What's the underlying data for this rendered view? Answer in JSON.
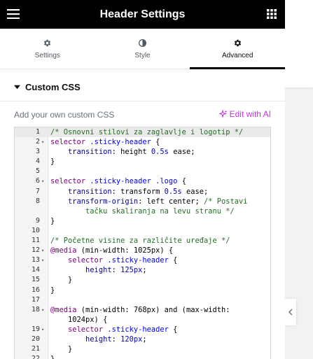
{
  "header": {
    "title": "Header Settings",
    "menu_icon": "hamburger-menu-icon",
    "grid_icon": "apps-grid-icon"
  },
  "tabs": [
    {
      "label": "Settings",
      "icon": "gear-icon",
      "active": false
    },
    {
      "label": "Style",
      "icon": "half-circle-icon",
      "active": false
    },
    {
      "label": "Advanced",
      "icon": "gear-icon",
      "active": true
    }
  ],
  "section": {
    "title": "Custom CSS",
    "expanded": true
  },
  "custom_css": {
    "label": "Add your own custom CSS",
    "edit_ai_label": "Edit with AI"
  },
  "colors": {
    "accent": "#c034e3",
    "header_bg": "#000000",
    "active_tab_underline": "#000000"
  },
  "editor": {
    "lines": [
      {
        "num": "1",
        "fold": false,
        "active": true,
        "tokens": [
          {
            "t": "/* Osnovni stilovi za zaglavlje i logotip */",
            "c": "comment"
          }
        ]
      },
      {
        "num": "2",
        "fold": true,
        "tokens": [
          {
            "t": "selector ",
            "c": "kw"
          },
          {
            "t": ".sticky-header",
            "c": "sel"
          },
          {
            "t": " {",
            "c": "text"
          }
        ]
      },
      {
        "num": "3",
        "fold": false,
        "tokens": [
          {
            "t": "    transition",
            "c": "prop"
          },
          {
            "t": ": height ",
            "c": "text"
          },
          {
            "t": "0.5s",
            "c": "num"
          },
          {
            "t": " ease;",
            "c": "text"
          }
        ]
      },
      {
        "num": "4",
        "fold": false,
        "tokens": [
          {
            "t": "}",
            "c": "text"
          }
        ]
      },
      {
        "num": "5",
        "fold": false,
        "tokens": []
      },
      {
        "num": "6",
        "fold": true,
        "tokens": [
          {
            "t": "selector ",
            "c": "kw"
          },
          {
            "t": ".sticky-header .logo",
            "c": "sel"
          },
          {
            "t": " {",
            "c": "text"
          }
        ]
      },
      {
        "num": "7",
        "fold": false,
        "tokens": [
          {
            "t": "    transition",
            "c": "prop"
          },
          {
            "t": ": transform ",
            "c": "text"
          },
          {
            "t": "0.5s",
            "c": "num"
          },
          {
            "t": " ease;",
            "c": "text"
          }
        ]
      },
      {
        "num": "8",
        "fold": false,
        "tokens": [
          {
            "t": "    transform-origin",
            "c": "prop"
          },
          {
            "t": ": left center; ",
            "c": "text"
          },
          {
            "t": "/* Postavi",
            "c": "comment"
          }
        ]
      },
      {
        "num": "",
        "fold": false,
        "tokens": [
          {
            "t": "        tačku skaliranja na levu stranu */",
            "c": "comment"
          }
        ]
      },
      {
        "num": "9",
        "fold": false,
        "tokens": [
          {
            "t": "}",
            "c": "text"
          }
        ]
      },
      {
        "num": "10",
        "fold": false,
        "tokens": []
      },
      {
        "num": "11",
        "fold": false,
        "tokens": [
          {
            "t": "/* Početne visine za različite uređaje */",
            "c": "comment"
          }
        ]
      },
      {
        "num": "12",
        "fold": true,
        "tokens": [
          {
            "t": "@media",
            "c": "kw"
          },
          {
            "t": " (min-width: ",
            "c": "text"
          },
          {
            "t": "1025px",
            "c": "text"
          },
          {
            "t": ") {",
            "c": "text"
          }
        ]
      },
      {
        "num": "13",
        "fold": true,
        "tokens": [
          {
            "t": "    selector ",
            "c": "kw"
          },
          {
            "t": ".sticky-header",
            "c": "sel"
          },
          {
            "t": " {",
            "c": "text"
          }
        ]
      },
      {
        "num": "14",
        "fold": false,
        "tokens": [
          {
            "t": "        height",
            "c": "prop"
          },
          {
            "t": ": ",
            "c": "text"
          },
          {
            "t": "125px",
            "c": "num"
          },
          {
            "t": ";",
            "c": "text"
          }
        ]
      },
      {
        "num": "15",
        "fold": false,
        "tokens": [
          {
            "t": "    }",
            "c": "text"
          }
        ]
      },
      {
        "num": "16",
        "fold": false,
        "tokens": [
          {
            "t": "}",
            "c": "text"
          }
        ]
      },
      {
        "num": "17",
        "fold": false,
        "tokens": []
      },
      {
        "num": "18",
        "fold": true,
        "tokens": [
          {
            "t": "@media",
            "c": "kw"
          },
          {
            "t": " (min-width: 768px) and (max-width:",
            "c": "text"
          }
        ]
      },
      {
        "num": "",
        "fold": false,
        "tokens": [
          {
            "t": "    1024px) {",
            "c": "text"
          }
        ]
      },
      {
        "num": "19",
        "fold": true,
        "tokens": [
          {
            "t": "    selector ",
            "c": "kw"
          },
          {
            "t": ".sticky-header",
            "c": "sel"
          },
          {
            "t": " {",
            "c": "text"
          }
        ]
      },
      {
        "num": "20",
        "fold": false,
        "tokens": [
          {
            "t": "        height",
            "c": "prop"
          },
          {
            "t": ": ",
            "c": "text"
          },
          {
            "t": "120px",
            "c": "num"
          },
          {
            "t": ";",
            "c": "text"
          }
        ]
      },
      {
        "num": "21",
        "fold": false,
        "tokens": [
          {
            "t": "    }",
            "c": "text"
          }
        ]
      },
      {
        "num": "22",
        "fold": false,
        "tokens": [
          {
            "t": "}",
            "c": "text"
          }
        ]
      }
    ]
  }
}
